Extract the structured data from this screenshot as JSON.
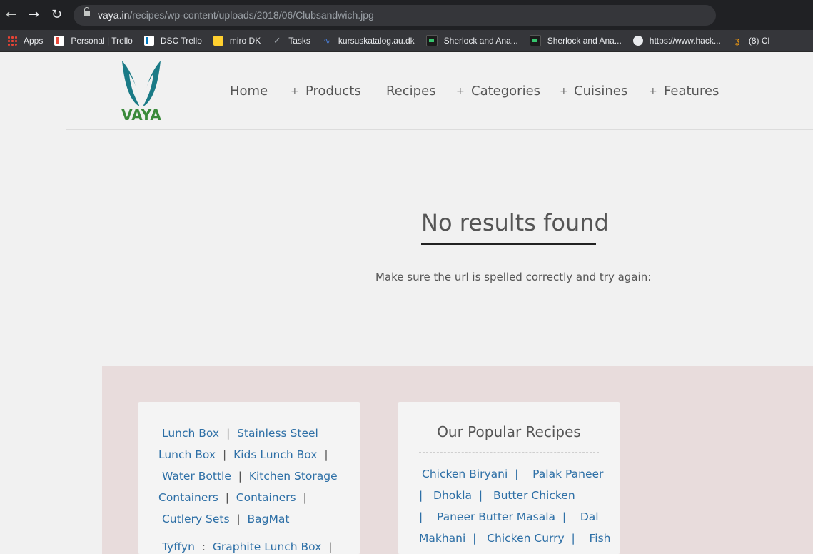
{
  "browser": {
    "url_domain": "vaya.in",
    "url_path": "/recipes/wp-content/uploads/2018/06/Clubsandwich.jpg",
    "bookmarks": [
      {
        "label": "Apps",
        "icon": "apps-icon"
      },
      {
        "label": "Personal | Trello",
        "icon": "trello-icon"
      },
      {
        "label": "DSC Trello",
        "icon": "trello-icon"
      },
      {
        "label": "miro DK",
        "icon": "miro-icon"
      },
      {
        "label": "Tasks",
        "icon": "check-icon"
      },
      {
        "label": "kursuskatalog.au.dk",
        "icon": "kursus-icon"
      },
      {
        "label": "Sherlock and Ana...",
        "icon": "sherlock-icon"
      },
      {
        "label": "Sherlock and Ana...",
        "icon": "sherlock-icon"
      },
      {
        "label": "https://www.hack...",
        "icon": "globe-icon"
      },
      {
        "label": "(8) Cl",
        "icon": "hack-icon"
      }
    ]
  },
  "site": {
    "logo_text": "VAYA",
    "nav": [
      "Home",
      "Products",
      "Recipes",
      "Categories",
      "Cuisines",
      "Features"
    ],
    "heading": "No results found",
    "message": "Make sure the url is spelled correctly and try again:",
    "colors": {
      "brand_teal": "#1a7a86",
      "brand_green": "#3a8a3a",
      "link": "#2d6fa6",
      "footer_bg": "#e8dcdc"
    }
  },
  "footer": {
    "products_links": [
      "Lunch Box",
      "Stainless Steel Lunch Box",
      "Kids Lunch Box",
      "Water Bottle",
      "Kitchen Storage Containers",
      "Containers",
      "Cutlery Sets",
      "BagMat",
      "Tyffyn",
      "Graphite Lunch Box"
    ],
    "popular_title": "Our Popular Recipes",
    "recipes": [
      "Chicken Biryani",
      "Palak Paneer",
      "Dhokla",
      "Butter Chicken",
      "Paneer Butter Masala",
      "Dal Makhani",
      "Chicken Curry",
      "Fish"
    ]
  }
}
